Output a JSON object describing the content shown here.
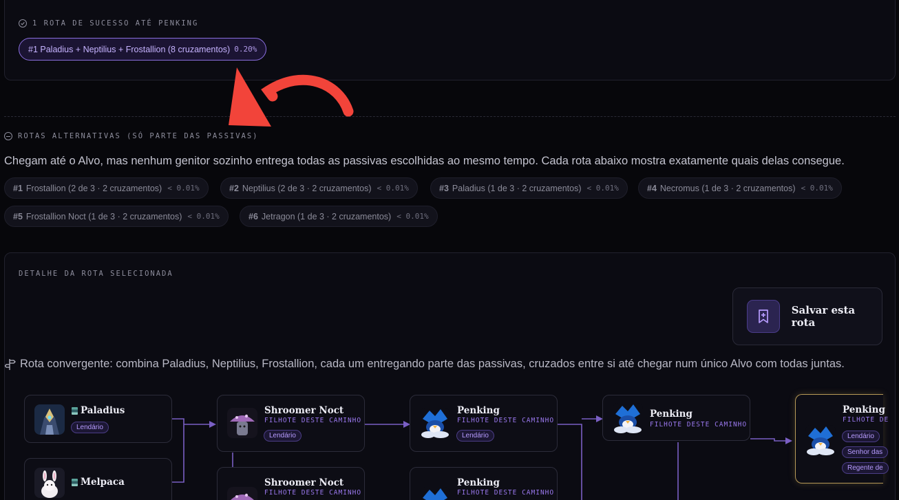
{
  "success": {
    "caption": "1 ROTA DE SUCESSO ATÉ PENKING",
    "chip_label": "#1  Paladius + Neptilius + Frostallion (8 cruzamentos)",
    "chip_pct": "0.20%"
  },
  "alternatives": {
    "caption": "ROTAS ALTERNATIVAS (SÓ PARTE DAS PASSIVAS)",
    "description": "Chegam até o Alvo, mas nenhum genitor sozinho entrega todas as passivas escolhidas ao mesmo tempo. Cada rota abaixo mostra exatamente quais delas consegue.",
    "chips": [
      {
        "num": "#1",
        "label": "Frostallion (2 de 3 · 2 cruzamentos)",
        "pct": "< 0.01%"
      },
      {
        "num": "#2",
        "label": "Neptilius (2 de 3 · 2 cruzamentos)",
        "pct": "< 0.01%"
      },
      {
        "num": "#3",
        "label": "Paladius (1 de 3 · 2 cruzamentos)",
        "pct": "< 0.01%"
      },
      {
        "num": "#4",
        "label": "Necromus (1 de 3 · 2 cruzamentos)",
        "pct": "< 0.01%"
      },
      {
        "num": "#5",
        "label": "Frostallion Noct (1 de 3 · 2 cruzamentos)",
        "pct": "< 0.01%"
      },
      {
        "num": "#6",
        "label": "Jetragon (1 de 3 · 2 cruzamentos)",
        "pct": "< 0.01%"
      }
    ]
  },
  "detail": {
    "caption": "DETALHE DA ROTA SELECIONADA",
    "save_label": "Salvar esta rota",
    "route_description": "Rota convergente: combina Paladius, Neptilius, Frostallion, cada um entregando parte das passivas, cruzados entre si até chegar num único Alvo com todas juntas.",
    "nodes": [
      {
        "name": "Paladius",
        "sub": "",
        "tags": [
          "Lendário"
        ],
        "icon": "paladius-avatar"
      },
      {
        "name": "Melpaca",
        "sub": "",
        "tags": [],
        "icon": "melpaca-avatar"
      },
      {
        "name": "Shroomer Noct",
        "sub": "FILHOTE DESTE CAMINHO",
        "tags": [
          "Lendário"
        ],
        "icon": "shroomer-avatar"
      },
      {
        "name": "Shroomer Noct",
        "sub": "FILHOTE DESTE CAMINHO",
        "tags": [],
        "icon": "shroomer-avatar"
      },
      {
        "name": "Penking",
        "sub": "FILHOTE DESTE CAMINHO",
        "tags": [
          "Lendário"
        ],
        "icon": "penking-avatar"
      },
      {
        "name": "Penking",
        "sub": "FILHOTE DESTE CAMINHO",
        "tags": [],
        "icon": "penking-avatar"
      },
      {
        "name": "Penking",
        "sub": "FILHOTE DESTE CAMINHO",
        "tags": [],
        "icon": "penking-avatar"
      },
      {
        "name": "Penking",
        "sub": "FILHOTE DE",
        "tags": [
          "Lendário",
          "Senhor das",
          "Regente de"
        ],
        "icon": "penking-avatar"
      }
    ]
  },
  "colors": {
    "accent": "#8b6fe0",
    "annotation_arrow": "#f2443a",
    "target_border": "#b89a57"
  }
}
